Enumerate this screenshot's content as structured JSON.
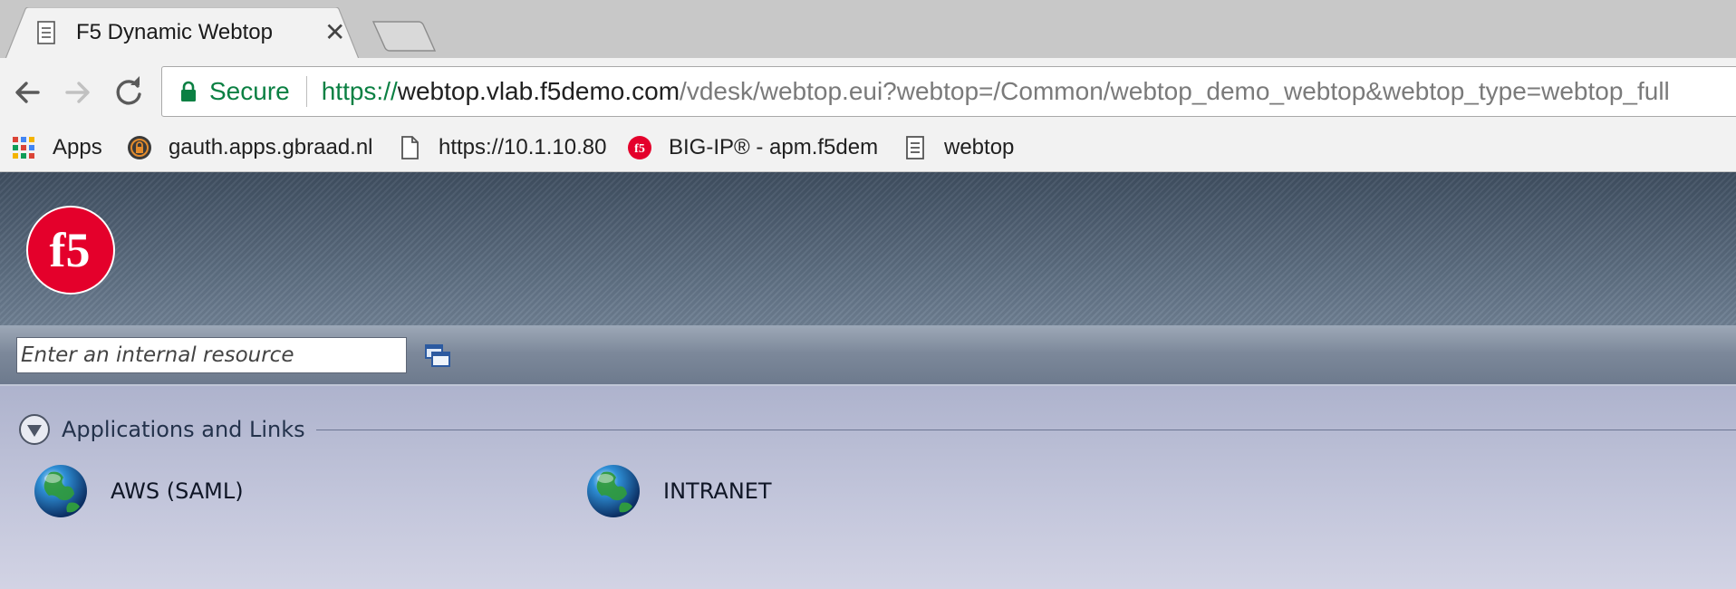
{
  "browser": {
    "tab": {
      "title": "F5 Dynamic Webtop",
      "close_glyph": "✕",
      "icon": "document-icon"
    },
    "toolbar": {
      "secure_label": "Secure",
      "url": {
        "scheme": "https://",
        "host": "webtop.vlab.f5demo.com",
        "path": "/vdesk/webtop.eui?webtop=/Common/webtop_demo_webtop&webtop_type=webtop_full"
      }
    },
    "bookmarks": [
      {
        "label": "Apps",
        "icon": "apps-grid-icon"
      },
      {
        "label": "gauth.apps.gbraad.nl",
        "icon": "lock-badge-icon"
      },
      {
        "label": "https://10.1.10.80",
        "icon": "document-icon"
      },
      {
        "label": "BIG-IP® - apm.f5dem",
        "icon": "f5-icon"
      },
      {
        "label": "webtop",
        "icon": "document-icon"
      }
    ]
  },
  "webtop": {
    "search": {
      "placeholder": "Enter an internal resource"
    },
    "section": {
      "title": "Applications and Links",
      "items": [
        {
          "label": "AWS (SAML)",
          "icon": "globe-icon"
        },
        {
          "label": "INTRANET",
          "icon": "globe-icon"
        }
      ]
    }
  },
  "colors": {
    "secure_green": "#0b8043",
    "f5_red": "#e4002b",
    "header_slate": "#4f5f72",
    "content_lavender": "#c4c7dc"
  }
}
